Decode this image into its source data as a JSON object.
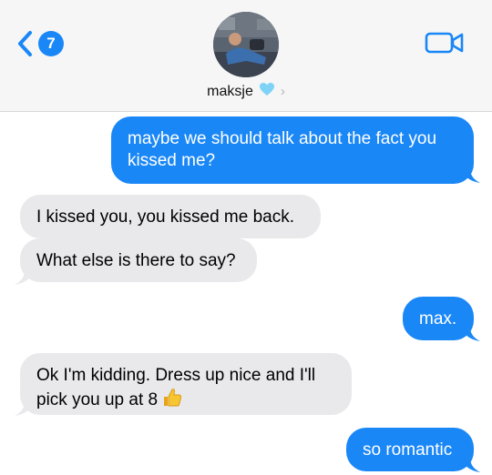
{
  "header": {
    "back_count": "7",
    "contact_name": "maksje",
    "heart_icon": "light-blue-heart-emoji",
    "chevron": "›",
    "video_icon": "video-camera-icon",
    "accent_color": "#1a87f7"
  },
  "messages": [
    {
      "direction": "outgoing",
      "text": "maybe we should talk about the fact you kissed me?"
    },
    {
      "direction": "incoming",
      "text": "I kissed you, you kissed me back."
    },
    {
      "direction": "incoming",
      "text": "What else is there to say?"
    },
    {
      "direction": "outgoing",
      "text": "max."
    },
    {
      "direction": "incoming",
      "text": "Ok I'm kidding. Dress up nice and I'll pick you up at 8",
      "emoji": "thumbs-up-emoji"
    },
    {
      "direction": "outgoing",
      "text": "so romantic"
    }
  ]
}
